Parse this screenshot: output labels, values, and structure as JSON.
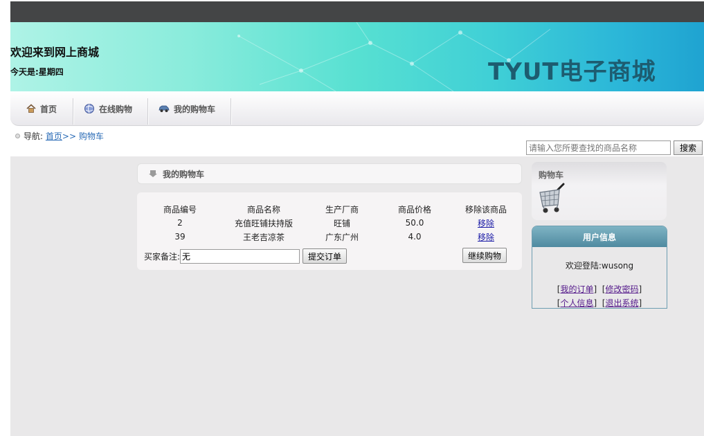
{
  "header": {
    "welcome": "欢迎来到网上商城",
    "today": "今天是:星期四",
    "brand": "TYUT电子商城"
  },
  "nav": {
    "items": [
      {
        "label": "首页",
        "icon": "home-icon"
      },
      {
        "label": "在线购物",
        "icon": "globe-icon"
      },
      {
        "label": "我的购物车",
        "icon": "car-icon"
      }
    ]
  },
  "breadcrumb": {
    "prefix": "导航:",
    "home": "首页",
    "separator": ">>",
    "current": "购物车"
  },
  "search": {
    "placeholder": "请输入您所要查找的商品名称",
    "button": "搜索"
  },
  "cart": {
    "title": "我的购物车",
    "columns": [
      "商品编号",
      "商品名称",
      "生产厂商",
      "商品价格",
      "移除该商品"
    ],
    "rows": [
      {
        "id": "2",
        "name": "充值旺铺扶持版",
        "maker": "旺铺",
        "price": "50.0",
        "remove": "移除"
      },
      {
        "id": "39",
        "name": "王老吉凉茶",
        "maker": "广东广州",
        "price": "4.0",
        "remove": "移除"
      }
    ],
    "note_label": "买家备注:",
    "note_value": "无",
    "submit": "提交订单",
    "continue": "继续购物"
  },
  "side_cart": {
    "title": "购物车"
  },
  "user": {
    "title": "用户信息",
    "welcome": "欢迎登陆:wusong",
    "links": [
      "我的订单",
      "修改密码",
      "个人信息",
      "退出系统"
    ]
  },
  "colors": {
    "topbar": "#444546",
    "brand": "#1d5c70",
    "link": "#2a6bb6",
    "user_head": "#5d97ab"
  }
}
